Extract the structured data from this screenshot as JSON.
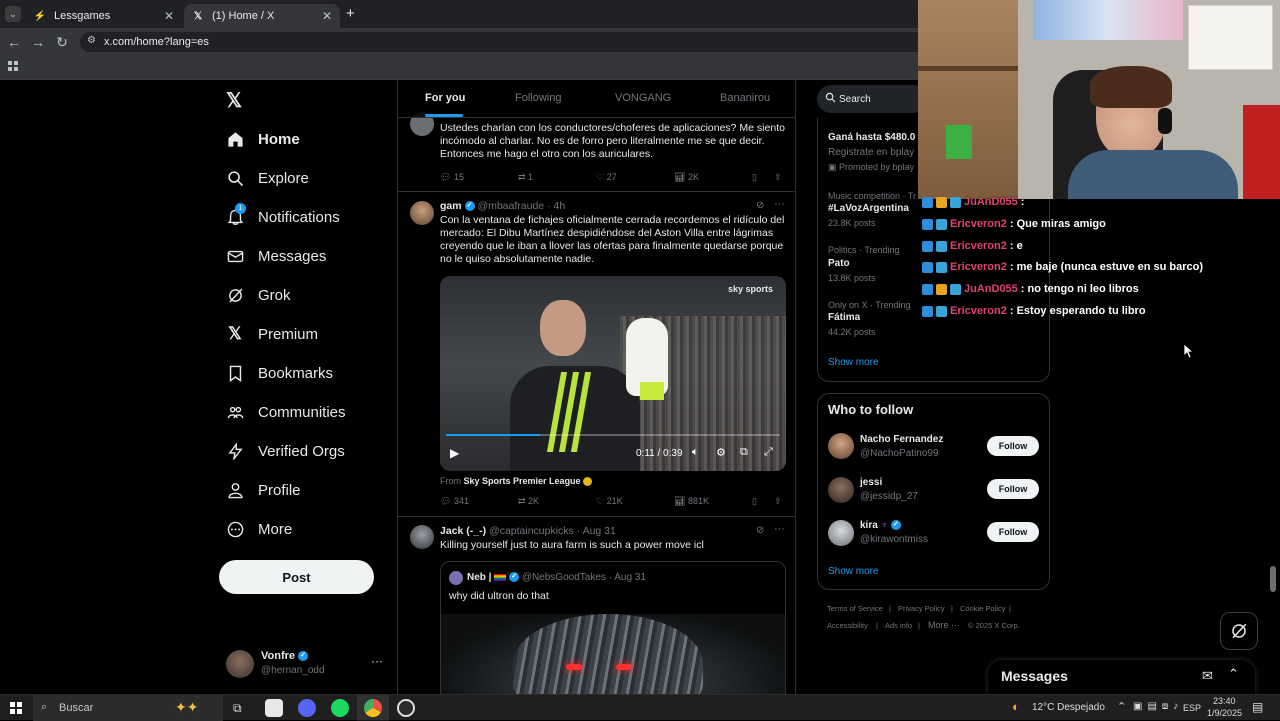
{
  "browser": {
    "tabs": [
      {
        "title": "Lessgames",
        "active": false
      },
      {
        "title": "(1) Home / X",
        "active": true
      }
    ],
    "new_tab": "+",
    "url": "x.com/home?lang=es"
  },
  "sidebar": {
    "items": [
      {
        "label": "Home",
        "icon": "home-icon"
      },
      {
        "label": "Explore",
        "icon": "search-icon"
      },
      {
        "label": "Notifications",
        "icon": "bell-icon",
        "badge": "1"
      },
      {
        "label": "Messages",
        "icon": "mail-icon"
      },
      {
        "label": "Grok",
        "icon": "grok-icon"
      },
      {
        "label": "Premium",
        "icon": "x-logo-icon"
      },
      {
        "label": "Bookmarks",
        "icon": "bookmark-icon"
      },
      {
        "label": "Communities",
        "icon": "communities-icon"
      },
      {
        "label": "Verified Orgs",
        "icon": "lightning-icon"
      },
      {
        "label": "Profile",
        "icon": "person-icon"
      },
      {
        "label": "More",
        "icon": "more-circle-icon"
      }
    ],
    "post_label": "Post",
    "account": {
      "name": "Vonfre",
      "handle": "@hernan_odd",
      "more": "···"
    }
  },
  "feed": {
    "tabs": [
      "For you",
      "Following",
      "VONGANG",
      "Bananirou"
    ],
    "tweets": [
      {
        "text": "Ustedes charlan con los conductores/choferes de aplicaciones? Me siento incómodo al charlar. No es de forro pero literalmente me se que decir. Entonces me hago el otro con los auriculares.",
        "replies": "15",
        "retweets": "1",
        "likes": "27",
        "views": "2K"
      },
      {
        "name": "gam",
        "handle": "@mbaafraude",
        "time": "· 4h",
        "text": "Con la ventana de fichajes oficialmente cerrada recordemos el ridículo del mercado: El Dibu Martínez despidiéndose del Aston Villa entre lágrimas creyendo que le iban a llover las ofertas para finalmente quedarse porque no le quiso absolutamente nadie.",
        "video_brand": "sky sports",
        "video_time": "0:11 / 0:39",
        "video_progress": 0.28,
        "source_prefix": "From",
        "source": "Sky Sports Premier League",
        "replies": "341",
        "retweets": "2K",
        "likes": "21K",
        "views": "881K"
      },
      {
        "name": "Jack (-_-)",
        "handle": "@captaincupkicks",
        "time": "· Aug 31",
        "text": "Killing yourself just to aura farm is such a power move icl",
        "quote": {
          "name": "Neb |",
          "handle": "@NebsGoodTakes",
          "time": "· Aug 31",
          "text": "why did ultron do that"
        }
      }
    ]
  },
  "right": {
    "search_placeholder": "Search",
    "promo": {
      "title": "Ganá hasta $480.0",
      "subtitle": "Registrate en bplay",
      "promoted": "Promoted by bplay"
    },
    "trends": [
      {
        "meta": "Music competition · Tr",
        "name": "#LaVozArgentina",
        "posts": "23.8K posts"
      },
      {
        "meta": "Politics · Trending",
        "name": "Pato",
        "posts": "13.8K posts"
      },
      {
        "meta": "Only on X · Trending",
        "name": "Fátima",
        "posts": "44.2K posts"
      }
    ],
    "show_more": "Show more",
    "who_to_follow": {
      "title": "Who to follow",
      "users": [
        {
          "name": "Nacho Fernandez",
          "handle": "@NachoPatino99",
          "button": "Follow"
        },
        {
          "name": "jessi",
          "handle": "@jessidp_27",
          "button": "Follow"
        },
        {
          "name": "kira",
          "handle": "@kirawontmiss",
          "button": "Follow"
        }
      ],
      "show_more": "Show more"
    },
    "footer": [
      "Terms of Service",
      "|",
      "Privacy Policy",
      "|",
      "Cookie Policy",
      "|",
      "Accessibility",
      "|",
      "Ads info",
      "|",
      "More ···",
      "© 2025 X Corp."
    ]
  },
  "chat": {
    "lines": [
      {
        "user": "JuAnD055",
        "msg": ":"
      },
      {
        "user": "Ericveron2",
        "msg": ": Que miras amigo"
      },
      {
        "user": "Ericveron2",
        "msg": ": e"
      },
      {
        "user": "Ericveron2",
        "msg": ": me baje (nunca estuve en su barco)"
      },
      {
        "user": "JuAnD055",
        "msg": ": no tengo ni leo libros"
      },
      {
        "user": "Ericveron2",
        "msg": ": Estoy esperando tu libro"
      }
    ]
  },
  "messages_drawer": {
    "title": "Messages"
  },
  "taskbar": {
    "search_label": "Buscar",
    "weather": "12°C  Despejado",
    "lang": "ESP",
    "time": "23:40",
    "date": "1/9/2025"
  },
  "colors": {
    "accent": "#1d9bf0",
    "bg": "#000000",
    "border": "#2f3336",
    "muted": "#71767b",
    "chat_user": "#e0436f"
  }
}
